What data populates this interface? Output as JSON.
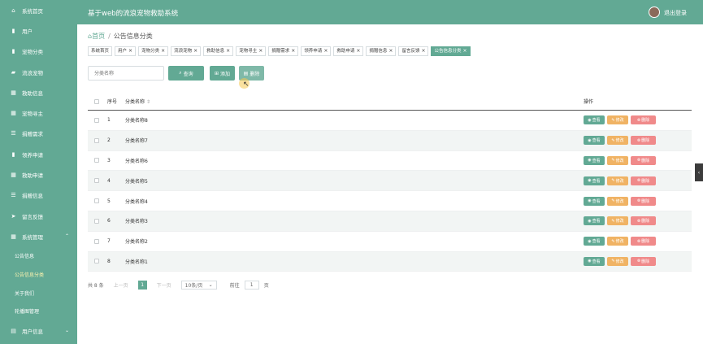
{
  "app_title": "基于web的流浪宠物救助系统",
  "user": {
    "logout_label": "退出登录"
  },
  "sidebar": {
    "items": [
      {
        "icon": "⌂",
        "label": "系统首页"
      },
      {
        "icon": "▮",
        "label": "用户"
      },
      {
        "icon": "▮",
        "label": "宠物分类"
      },
      {
        "icon": "▰",
        "label": "流浪宠物"
      },
      {
        "icon": "▦",
        "label": "救助信息"
      },
      {
        "icon": "▦",
        "label": "宠物寻主"
      },
      {
        "icon": "☰",
        "label": "捐赠需求"
      },
      {
        "icon": "▮",
        "label": "领养申请"
      },
      {
        "icon": "▦",
        "label": "救助申请"
      },
      {
        "icon": "☰",
        "label": "捐赠信息"
      },
      {
        "icon": "➤",
        "label": "留言反馈"
      }
    ],
    "system": {
      "icon": "▦",
      "label": "系统管理"
    },
    "sub_items": [
      "公告信息",
      "公告信息分类",
      "关于我们",
      "轮播图管理"
    ],
    "user_info": {
      "icon": "▤",
      "label": "用户信息"
    }
  },
  "breadcrumb": {
    "home": "首页",
    "current": "公告信息分类"
  },
  "tags": [
    {
      "label": "系统首页",
      "closable": false,
      "active": false
    },
    {
      "label": "用户",
      "closable": true,
      "active": false
    },
    {
      "label": "宠物分类",
      "closable": true,
      "active": false
    },
    {
      "label": "流浪宠物",
      "closable": true,
      "active": false
    },
    {
      "label": "救助信息",
      "closable": true,
      "active": false
    },
    {
      "label": "宠物寻主",
      "closable": true,
      "active": false
    },
    {
      "label": "捐赠需求",
      "closable": true,
      "active": false
    },
    {
      "label": "领养申请",
      "closable": true,
      "active": false
    },
    {
      "label": "救助申请",
      "closable": true,
      "active": false
    },
    {
      "label": "捐赠信息",
      "closable": true,
      "active": false
    },
    {
      "label": "留言反馈",
      "closable": true,
      "active": false
    },
    {
      "label": "公告信息分类",
      "closable": true,
      "active": true
    }
  ],
  "search": {
    "placeholder": "分类名称"
  },
  "buttons": {
    "query": "查询",
    "add": "添加",
    "delete": "删除"
  },
  "table": {
    "headers": {
      "no": "序号",
      "name": "分类名称",
      "op": "操作"
    },
    "rows": [
      {
        "no": "1",
        "name": "分类名称8"
      },
      {
        "no": "2",
        "name": "分类名称7"
      },
      {
        "no": "3",
        "name": "分类名称6"
      },
      {
        "no": "4",
        "name": "分类名称5"
      },
      {
        "no": "5",
        "name": "分类名称4"
      },
      {
        "no": "6",
        "name": "分类名称3"
      },
      {
        "no": "7",
        "name": "分类名称2"
      },
      {
        "no": "8",
        "name": "分类名称1"
      }
    ],
    "ops": {
      "view": "查看",
      "edit": "修改",
      "del": "删除"
    }
  },
  "pager": {
    "total": "共 8 条",
    "prev": "上一页",
    "current": "1",
    "next": "下一页",
    "page_size": "10条/页",
    "goto_prefix": "前往",
    "goto_value": "1",
    "goto_suffix": "页"
  },
  "colors": {
    "primary": "#62a994",
    "edit": "#f0b364",
    "delete": "#f08a8a"
  }
}
